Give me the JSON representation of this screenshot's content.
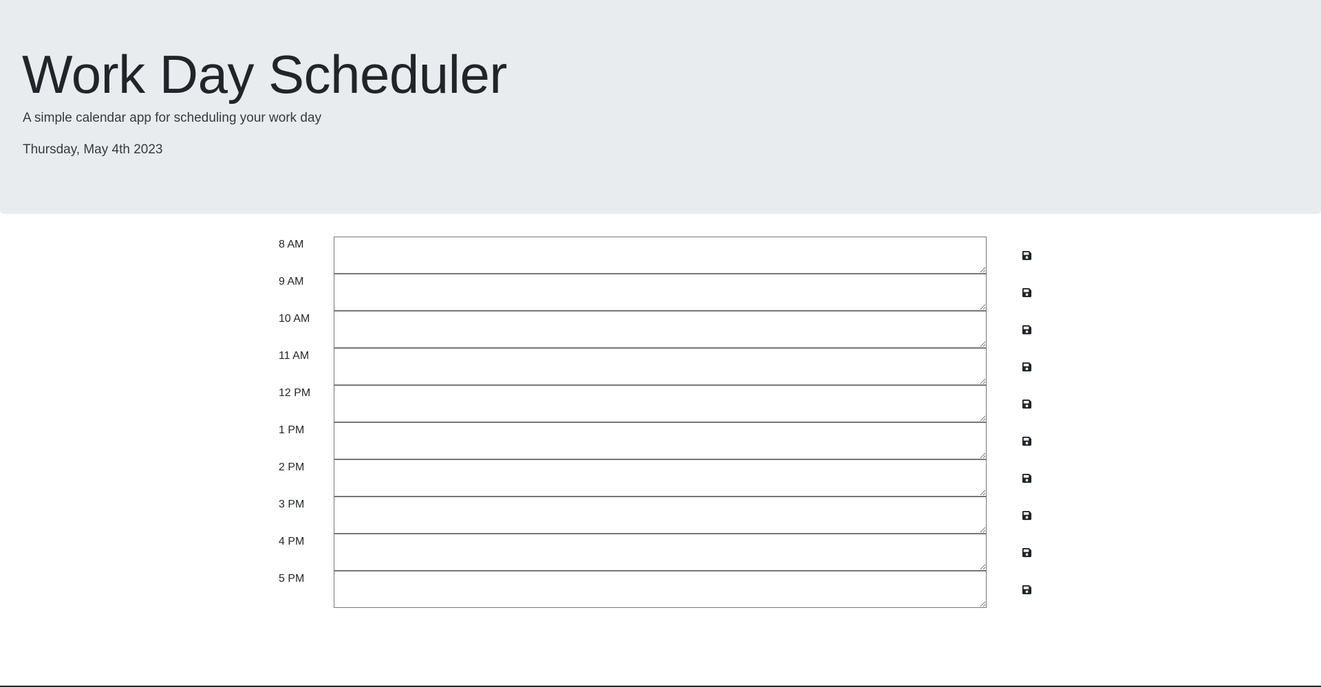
{
  "header": {
    "title": "Work Day Scheduler",
    "subtitle": "A simple calendar app for scheduling your work day",
    "current_date": "Thursday, May 4th 2023"
  },
  "timeblocks": [
    {
      "hour": "8 AM",
      "text": ""
    },
    {
      "hour": "9 AM",
      "text": ""
    },
    {
      "hour": "10 AM",
      "text": ""
    },
    {
      "hour": "11 AM",
      "text": ""
    },
    {
      "hour": "12 PM",
      "text": ""
    },
    {
      "hour": "1 PM",
      "text": ""
    },
    {
      "hour": "2 PM",
      "text": ""
    },
    {
      "hour": "3 PM",
      "text": ""
    },
    {
      "hour": "4 PM",
      "text": ""
    },
    {
      "hour": "5 PM",
      "text": ""
    }
  ],
  "icons": {
    "save": "floppy-disk-icon"
  },
  "colors": {
    "header_bg": "#e9ecef",
    "text": "#212529",
    "textarea_border": "#767676"
  }
}
